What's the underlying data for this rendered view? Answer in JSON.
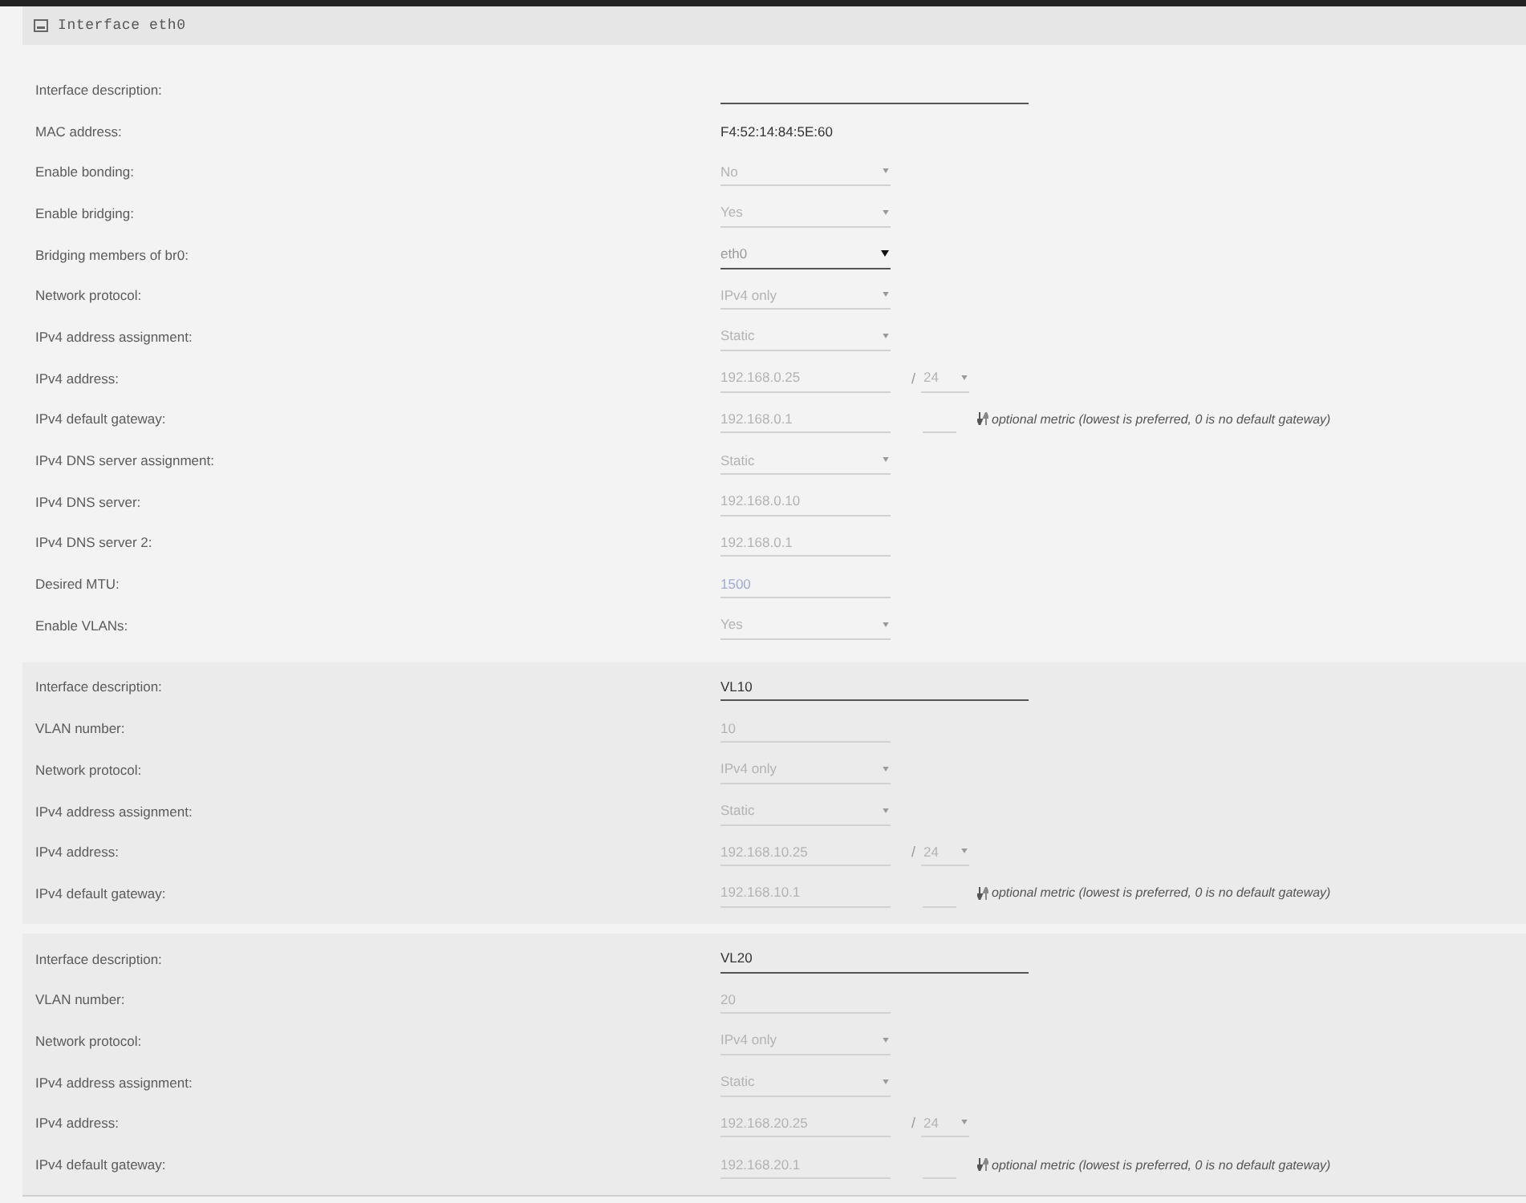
{
  "panel": {
    "title": "Interface eth0"
  },
  "sections": [
    {
      "kind": "main",
      "rows": [
        {
          "label": "Interface description:",
          "controls": [
            {
              "kind": "wide-text",
              "disabled": false
            }
          ]
        },
        {
          "label": "MAC address:",
          "controls": [
            {
              "kind": "static",
              "value": "F4:52:14:84:5E:60"
            }
          ]
        },
        {
          "label": "Enable bonding:",
          "controls": [
            {
              "kind": "select",
              "value": "No",
              "disabled": true
            }
          ]
        },
        {
          "label": "Enable bridging:",
          "controls": [
            {
              "kind": "select",
              "value": "Yes",
              "disabled": true
            }
          ]
        },
        {
          "label": "Bridging members of br0:",
          "controls": [
            {
              "kind": "select",
              "value": "eth0",
              "disabled": false
            }
          ]
        },
        {
          "label": "Network protocol:",
          "controls": [
            {
              "kind": "select",
              "value": "IPv4 only",
              "disabled": true
            }
          ]
        },
        {
          "label": "IPv4 address assignment:",
          "controls": [
            {
              "kind": "select",
              "value": "Static",
              "disabled": true
            }
          ]
        },
        {
          "label": "IPv4 address:",
          "controls": [
            {
              "kind": "text",
              "value": "192.168.0.25",
              "disabled": true
            },
            {
              "kind": "separator",
              "text": "/"
            },
            {
              "kind": "small-select",
              "value": "24",
              "disabled": true
            }
          ]
        },
        {
          "label": "IPv4 default gateway:",
          "controls": [
            {
              "kind": "text",
              "value": "192.168.0.1",
              "disabled": true
            },
            {
              "kind": "small-text",
              "disabled": true
            },
            {
              "kind": "note",
              "text": "optional metric (lowest is preferred, 0 is no default gateway)"
            }
          ]
        },
        {
          "label": "IPv4 DNS server assignment:",
          "controls": [
            {
              "kind": "select",
              "value": "Static",
              "disabled": true
            }
          ]
        },
        {
          "label": "IPv4 DNS server:",
          "controls": [
            {
              "kind": "text",
              "value": "192.168.0.10",
              "disabled": true
            }
          ]
        },
        {
          "label": "IPv4 DNS server 2:",
          "controls": [
            {
              "kind": "text",
              "value": "192.168.0.1",
              "disabled": true
            }
          ]
        },
        {
          "label": "Desired MTU:",
          "controls": [
            {
              "kind": "text",
              "placeholder": "1500",
              "disabled": true
            }
          ]
        },
        {
          "label": "Enable VLANs:",
          "controls": [
            {
              "kind": "select",
              "value": "Yes",
              "disabled": true
            }
          ]
        }
      ]
    },
    {
      "kind": "vlan",
      "rows": [
        {
          "label": "Interface description:",
          "controls": [
            {
              "kind": "wide-text",
              "value": "VL10",
              "disabled": false
            }
          ]
        },
        {
          "label": "VLAN number:",
          "controls": [
            {
              "kind": "text",
              "value": "10",
              "disabled": true
            }
          ]
        },
        {
          "label": "Network protocol:",
          "controls": [
            {
              "kind": "select",
              "value": "IPv4 only",
              "disabled": true
            }
          ]
        },
        {
          "label": "IPv4 address assignment:",
          "controls": [
            {
              "kind": "select",
              "value": "Static",
              "disabled": true
            }
          ]
        },
        {
          "label": "IPv4 address:",
          "controls": [
            {
              "kind": "text",
              "value": "192.168.10.25",
              "disabled": true
            },
            {
              "kind": "separator",
              "text": "/"
            },
            {
              "kind": "small-select",
              "value": "24",
              "disabled": true
            }
          ]
        },
        {
          "label": "IPv4 default gateway:",
          "controls": [
            {
              "kind": "text",
              "value": "192.168.10.1",
              "disabled": true
            },
            {
              "kind": "small-text",
              "disabled": true
            },
            {
              "kind": "note",
              "text": "optional metric (lowest is preferred, 0 is no default gateway)"
            }
          ]
        }
      ]
    },
    {
      "kind": "vlan",
      "rows": [
        {
          "label": "Interface description:",
          "controls": [
            {
              "kind": "wide-text",
              "value": "VL20",
              "disabled": false
            }
          ]
        },
        {
          "label": "VLAN number:",
          "controls": [
            {
              "kind": "text",
              "value": "20",
              "disabled": true
            }
          ]
        },
        {
          "label": "Network protocol:",
          "controls": [
            {
              "kind": "select",
              "value": "IPv4 only",
              "disabled": true
            }
          ]
        },
        {
          "label": "IPv4 address assignment:",
          "controls": [
            {
              "kind": "select",
              "value": "Static",
              "disabled": true
            }
          ]
        },
        {
          "label": "IPv4 address:",
          "controls": [
            {
              "kind": "text",
              "value": "192.168.20.25",
              "disabled": true
            },
            {
              "kind": "separator",
              "text": "/"
            },
            {
              "kind": "small-select",
              "value": "24",
              "disabled": true
            }
          ]
        },
        {
          "label": "IPv4 default gateway:",
          "controls": [
            {
              "kind": "text",
              "value": "192.168.20.1",
              "disabled": true
            },
            {
              "kind": "small-text",
              "disabled": true
            },
            {
              "kind": "note",
              "text": "optional metric (lowest is preferred, 0 is no default gateway)"
            }
          ]
        }
      ]
    }
  ]
}
